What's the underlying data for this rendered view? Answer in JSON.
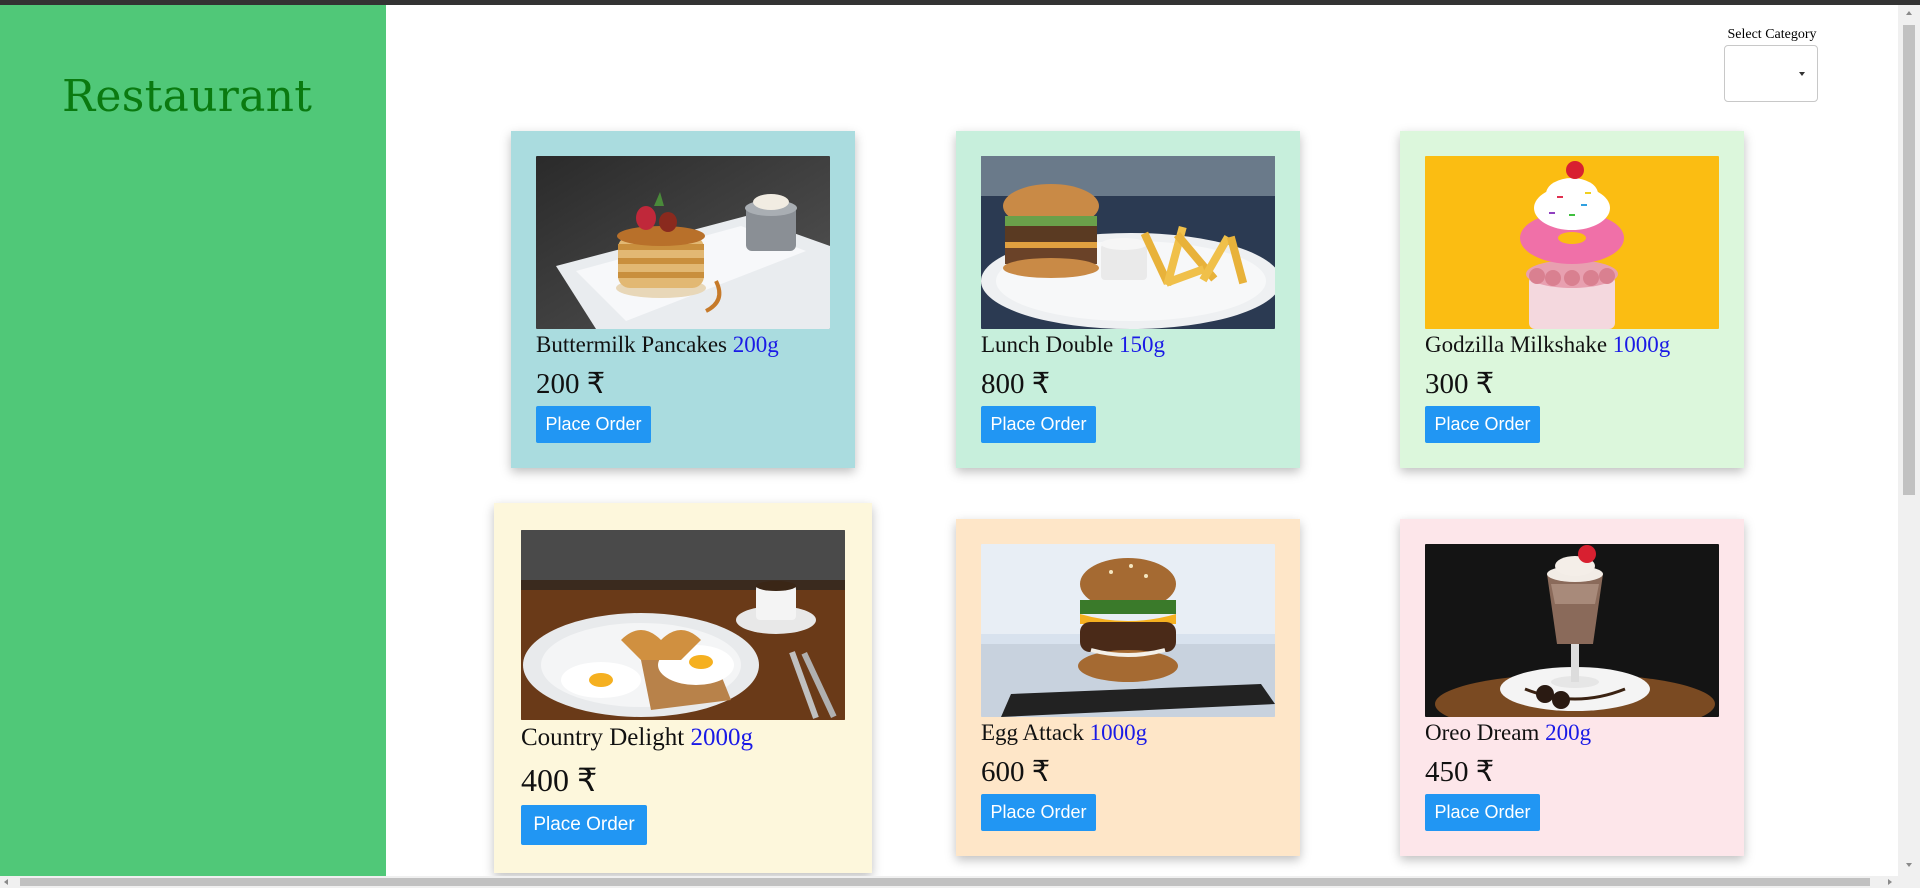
{
  "brand": {
    "name": "Restaurant"
  },
  "category_filter": {
    "label": "Select Category",
    "value": ""
  },
  "menu": {
    "items": [
      {
        "name": "Buttermilk Pancakes",
        "weight": "200g",
        "price": "200 ₹",
        "button": "Place Order",
        "card_color": "#aadcdf",
        "image": "pancakes-photo"
      },
      {
        "name": "Lunch Double",
        "weight": "150g",
        "price": "800 ₹",
        "button": "Place Order",
        "card_color": "#c7efdc",
        "image": "burger-fries-photo"
      },
      {
        "name": "Godzilla Milkshake",
        "weight": "1000g",
        "price": "300 ₹",
        "button": "Place Order",
        "card_color": "#dcf7dc",
        "image": "milkshake-donut-photo"
      },
      {
        "name": "Country Delight",
        "weight": "2000g",
        "price": "400 ₹",
        "button": "Place Order",
        "card_color": "#fdf7dc",
        "image": "eggs-toast-photo"
      },
      {
        "name": "Egg Attack",
        "weight": "1000g",
        "price": "600 ₹",
        "button": "Place Order",
        "card_color": "#fee6c8",
        "image": "egg-burger-photo"
      },
      {
        "name": "Oreo Dream",
        "weight": "200g",
        "price": "450 ₹",
        "button": "Place Order",
        "card_color": "#fde6ea",
        "image": "oreo-shake-photo"
      }
    ]
  },
  "colors": {
    "sidebar": "#50c878",
    "brand_text": "#0a7a10",
    "weight_text": "#1a1ae6",
    "button": "#2196f3"
  }
}
